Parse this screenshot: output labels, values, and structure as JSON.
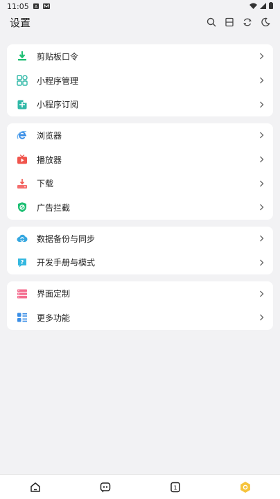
{
  "status_bar": {
    "time": "11:05"
  },
  "header": {
    "title": "设置"
  },
  "groups": [
    {
      "items": [
        {
          "label": "剪贴板口令"
        },
        {
          "label": "小程序管理"
        },
        {
          "label": "小程序订阅"
        }
      ]
    },
    {
      "items": [
        {
          "label": "浏览器"
        },
        {
          "label": "播放器"
        },
        {
          "label": "下载"
        },
        {
          "label": "广告拦截"
        }
      ]
    },
    {
      "items": [
        {
          "label": "数据备份与同步"
        },
        {
          "label": "开发手册与模式"
        }
      ]
    },
    {
      "items": [
        {
          "label": "界面定制"
        },
        {
          "label": "更多功能"
        }
      ]
    }
  ],
  "bottom_nav": {
    "page_badge": "1"
  },
  "colors": {
    "green": "#1dbf73",
    "teal": "#2fb8a7",
    "blue": "#3a8ee6",
    "red": "#f0554d",
    "cyan": "#35b8e0",
    "pink": "#f46d8f",
    "yellow": "#f6c33b"
  }
}
